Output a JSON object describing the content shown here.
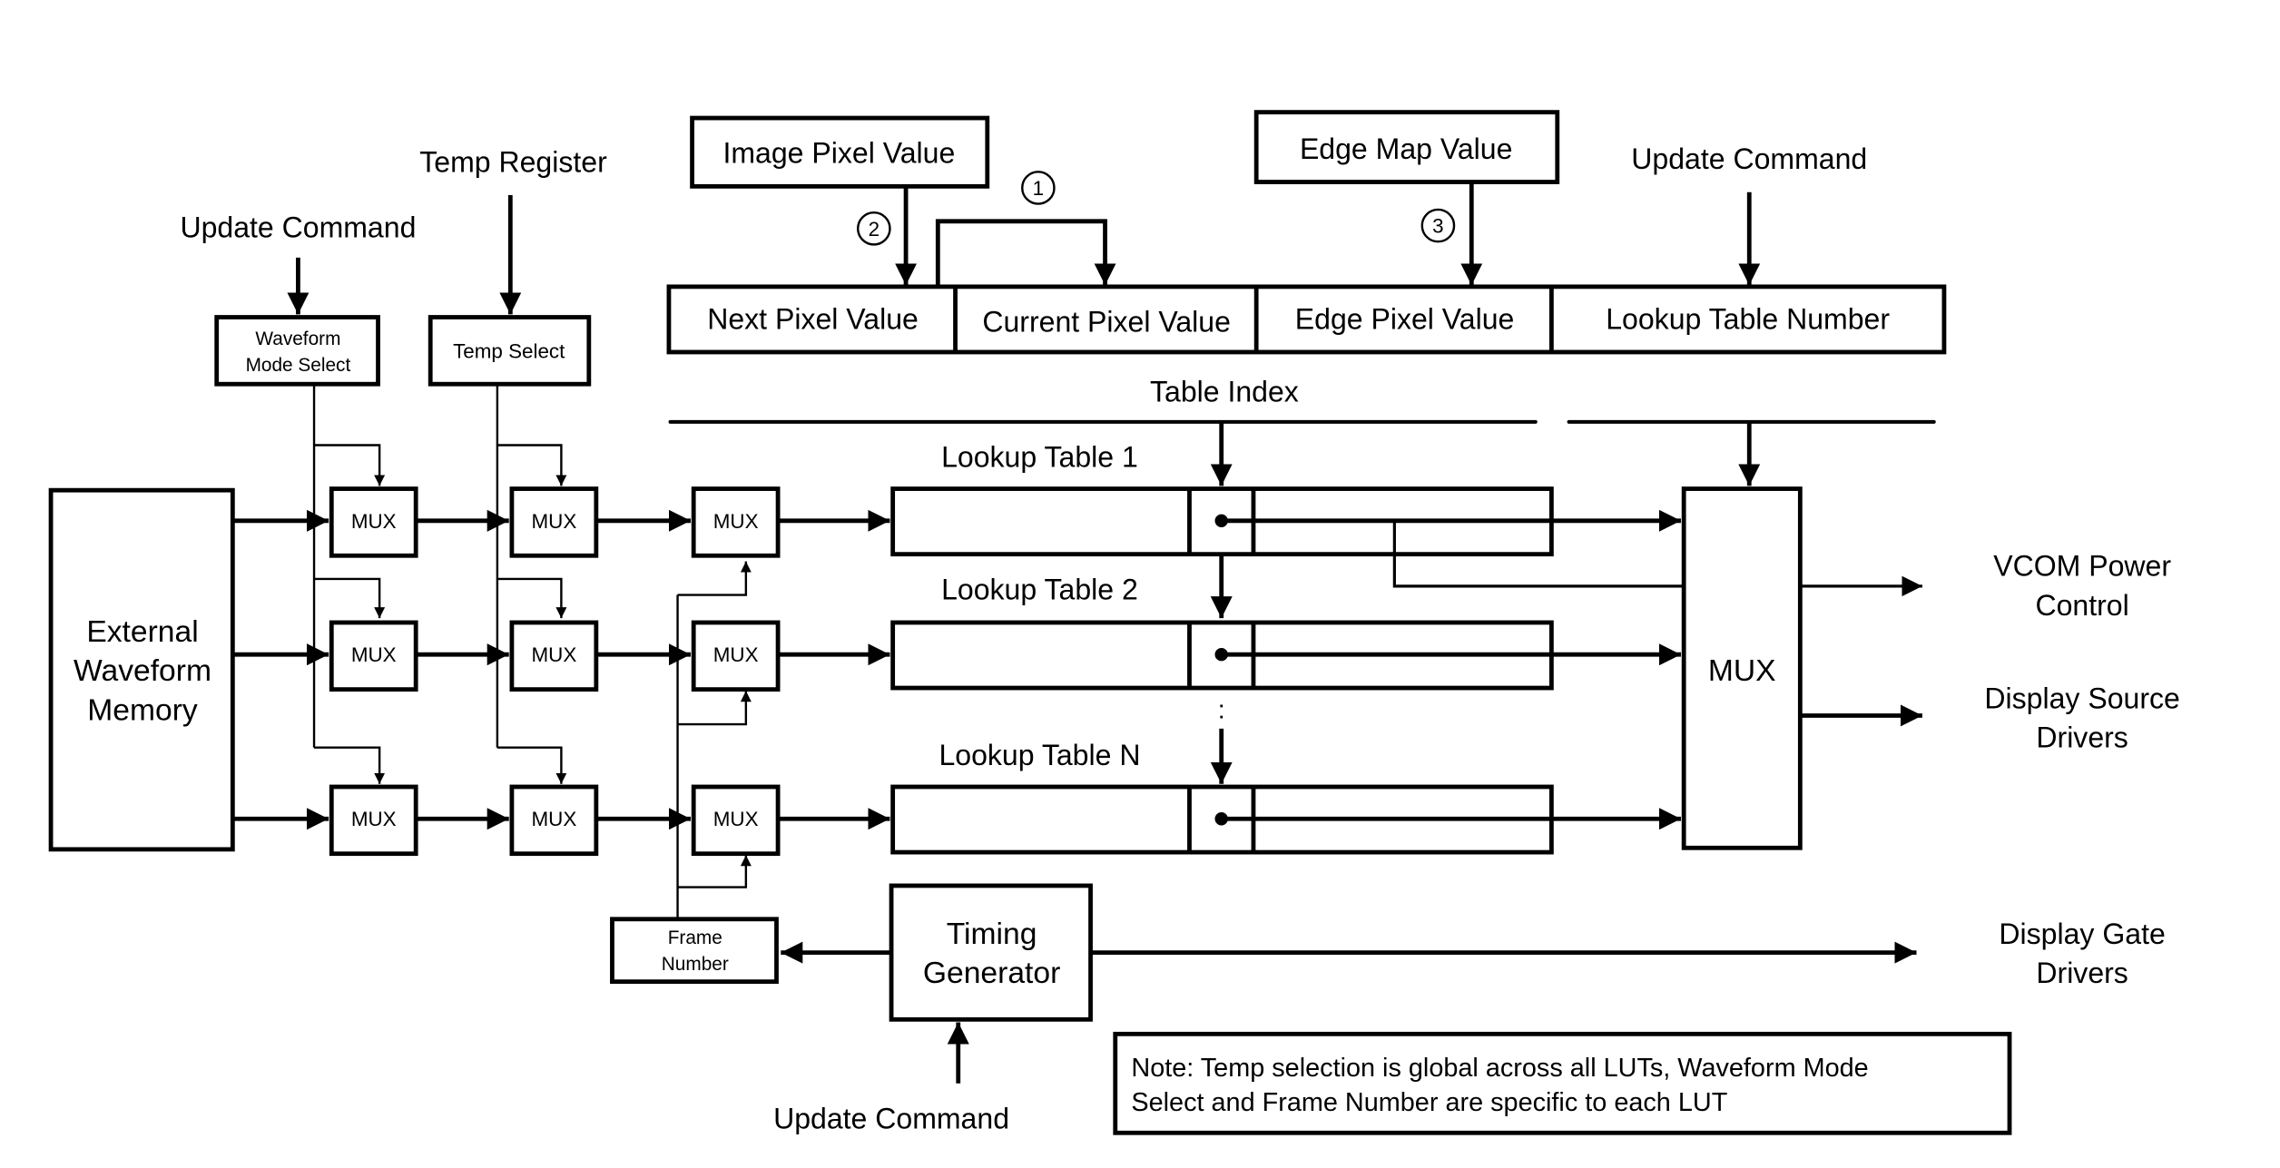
{
  "diagram": {
    "inputs": {
      "temp_register": "Temp Register",
      "update_command_left": "Update Command",
      "update_command_right": "Update Command",
      "update_command_bottom": "Update Command",
      "image_pixel_value": "Image Pixel Value",
      "edge_map_value": "Edge Map Value"
    },
    "selects": {
      "waveform_mode_select_line1": "Waveform",
      "waveform_mode_select_line2": "Mode Select",
      "temp_select": "Temp Select",
      "frame_number_line1": "Frame",
      "frame_number_line2": "Number"
    },
    "register": {
      "fields": [
        "Next Pixel Value",
        "Current Pixel Value",
        "Edge Pixel Value",
        "Lookup Table Number"
      ]
    },
    "steps": [
      "1",
      "2",
      "3"
    ],
    "table_index": "Table Index",
    "memory": {
      "line1": "External",
      "line2": "Waveform",
      "line3": "Memory"
    },
    "mux_label": "MUX",
    "lookup_tables": [
      "Lookup Table 1",
      "Lookup Table 2",
      "Lookup Table N"
    ],
    "ellipsis": ":",
    "output_mux": "MUX",
    "timing_generator": {
      "line1": "Timing",
      "line2": "Generator"
    },
    "outputs": {
      "vcom_line1": "VCOM Power",
      "vcom_line2": "Control",
      "source_line1": "Display Source",
      "source_line2": "Drivers",
      "gate_line1": "Display Gate",
      "gate_line2": "Drivers"
    },
    "note": {
      "line1": "Note: Temp selection is global across all LUTs, Waveform Mode",
      "line2": "Select and Frame Number are specific to each LUT"
    }
  }
}
